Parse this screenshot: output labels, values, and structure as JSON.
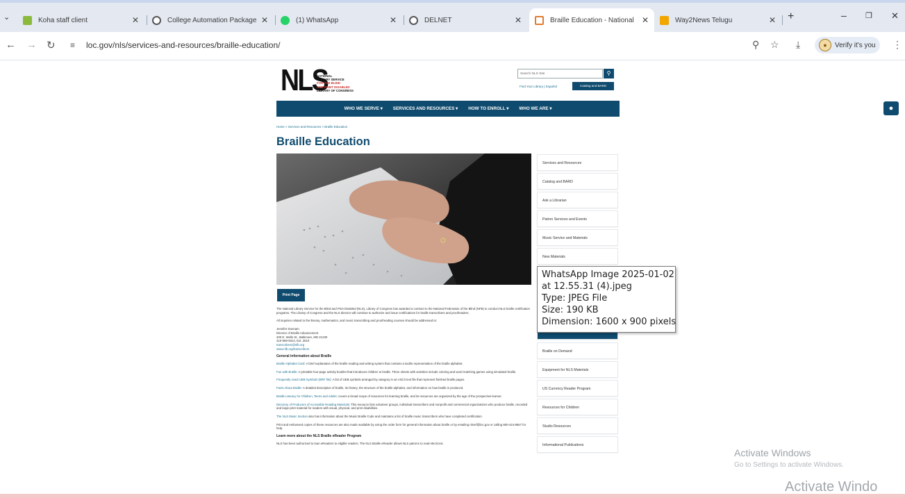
{
  "tabs": [
    {
      "label": "Koha staff client",
      "icon": "koha-icon",
      "color": "#8ab93c"
    },
    {
      "label": "College Automation Package",
      "icon": "globe-icon",
      "color": "#555555"
    },
    {
      "label": "(1) WhatsApp",
      "icon": "whatsapp-icon",
      "color": "#25d366"
    },
    {
      "label": "DELNET",
      "icon": "globe-icon",
      "color": "#555555"
    },
    {
      "label": "Braille Education - National",
      "icon": "loc-icon",
      "color": "#e07b32"
    },
    {
      "label": "Way2News Telugu",
      "icon": "way2news-icon",
      "color": "#f2a600"
    }
  ],
  "browser": {
    "url": "loc.gov/nls/services-and-resources/braille-education/",
    "profile_label": "Verify it's you"
  },
  "site": {
    "logo_big": "NLS",
    "logo_lines": [
      "NATIONAL",
      "LIBRARY SERVICE",
      "FOR THE BLIND",
      "AND PRINT DISABLED",
      "LIBRARY OF CONGRESS"
    ],
    "search_placeholder": "Search NLS Site",
    "util_links": "Find Your Library | Español",
    "catalog_button": "Catalog and BARD",
    "nav": [
      "WHO WE SERVE",
      "SERVICES AND RESOURCES",
      "HOW TO ENROLL",
      "WHO WE ARE"
    ],
    "breadcrumb": "Home > Services and Resources > Braille Education",
    "title": "Braille Education",
    "print_button": "Print Page"
  },
  "content": {
    "intro": "The National Library Service for the Blind and Print Disabled (NLS), Library of Congress has awarded a contract to the National Federation of the Blind (NFB) to conduct NLS braille certification programs. The Library of Congress and the NLS director will continue to authorize and issue certifications for braille transcribers and proofreaders.",
    "inquiries": "All inquiries related to the literary, mathematics, and music transcribing and proofreading courses should be addressed to:",
    "contact": [
      "Jennifer Dunnam",
      "Director of Braille Advancement",
      "200 E. Wells St., Baltimore, MD 21230",
      "410-659-9314, Ext. 2510",
      "transcribers@nfb.org",
      "www.nfb.org/transcribers"
    ],
    "general_heading": "General information about Braille",
    "items": [
      {
        "link": "Braille Alphabet Card:",
        "text": " A brief explanation of the braille reading and writing system that contains a tactile representation of the braille alphabet."
      },
      {
        "link": "Fun with Braille:",
        "text": " A printable four-page activity booklet that introduces children to braille. Three sheets with activities include coloring and word matching games using simulated braille."
      },
      {
        "link": "Frequently Used UEB Symbols (BRF file):",
        "text": " A list of UEB symbols arranged by category in an ASCII text file that represent finished braille pages."
      },
      {
        "link": "Facts About Braille:",
        "text": " A detailed description of braille, its history, the structure of the braille alphabet, and information on how braille is produced."
      },
      {
        "link": "Braille Literacy for Children, Teens and Adults:",
        "text": " covers a broad scope of resources for learning braille, and its resources are organized by the age of the prospective learner."
      },
      {
        "link": "Directory of Producers of Accessible Reading Materials:",
        "text": " This resource lists volunteer groups, individual transcribers and nonprofit and commercial organizations who produce braille, recorded and large-print material for readers with visual, physical, and print disabilities."
      },
      {
        "link": "The NLS Music Section",
        "text": " also has information about the Music Braille Code and maintains a list of braille music transcribers who have completed certification."
      }
    ],
    "print_note": "Print and embossed copies of these resources are also made available by using the order form for general information about braille or by emailing nlsref@loc.gov or calling 800-424-8567 for help.",
    "learn_heading": "Learn more about the NLS Braille eReader Program",
    "learn_text": "NLS has been authorized to loan eReaders to eligible readers. The NLS Braille eReader allows NLS patrons to read electronic"
  },
  "sidebar": [
    "Services and Resources",
    "Catalog and BARD",
    "Ask a Librarian",
    "Patron Services and Events",
    "Music Service and Materials",
    "New Materials",
    "",
    "",
    "",
    "Braille on Demand",
    "Equipment for NLS Materials",
    "US Currency Reader Program",
    "Resources for Children",
    "Studio Resources",
    "Informational Publications"
  ],
  "tooltip": {
    "line1": "WhatsApp Image 2025-01-02",
    "line2": "at 12.55.31 (4).jpeg",
    "line3": "Type: JPEG File",
    "line4": "Size: 190 KB",
    "line5": "Dimension: 1600 x 900 pixels"
  },
  "watermark": {
    "title": "Activate Windows",
    "subtitle": "Go to Settings to activate Windows.",
    "bottom": "Activate Windo"
  },
  "colors": {
    "navy": "#0f4b6e",
    "link": "#1b6e8f"
  }
}
